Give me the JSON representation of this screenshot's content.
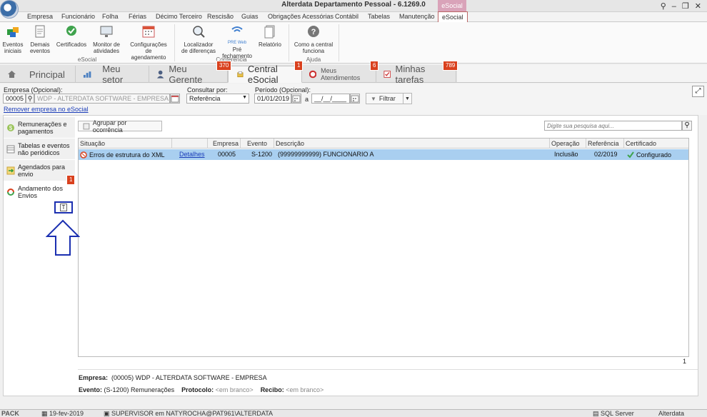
{
  "window": {
    "title": "Alterdata Departamento Pessoal - 6.1269.0",
    "context_tab": "eSocial"
  },
  "menu": [
    "Empresa",
    "Funcionário",
    "Folha",
    "Férias",
    "Décimo Terceiro",
    "Rescisão",
    "Guias",
    "Obrigações Acessórias",
    "Contábil",
    "Tabelas",
    "Manutenção",
    "eSocial"
  ],
  "ribbon": {
    "groups": [
      {
        "label": "eSocial",
        "buttons": [
          "Eventos iniciais",
          "Demais eventos",
          "Certificados",
          "Monitor de atividades",
          "Configurações de agendamento"
        ]
      },
      {
        "label": "Conferência",
        "buttons": [
          "Localizador de diferenças",
          "Pré fechamento",
          "Relatório"
        ]
      },
      {
        "label": "Ajuda",
        "buttons": [
          "Como a central funciona"
        ]
      }
    ],
    "pre_icon_text": "PRE Web"
  },
  "tabs": [
    {
      "label": "Principal",
      "badge": ""
    },
    {
      "label": "Meu setor",
      "badge": ""
    },
    {
      "label": "Meu Gerente",
      "badge": "370"
    },
    {
      "label": "Central eSocial",
      "badge": "1"
    },
    {
      "label": "Meus Atendimentos",
      "badge": "6"
    },
    {
      "label": "Minhas tarefas",
      "badge": "789"
    }
  ],
  "filters": {
    "empresa_label": "Empresa (Opcional):",
    "empresa_code": "00005",
    "empresa_name": "WDP - ALTERDATA SOFTWARE - EMPRESA",
    "remove_link": "Remover empresa no eSocial",
    "consultar_label": "Consultar por:",
    "consultar_value": "Referência",
    "periodo_label": "Período (Opcional):",
    "periodo_from": "01/01/2019",
    "periodo_sep": "a",
    "periodo_to": "__/__/____",
    "filtrar_label": "Filtrar"
  },
  "sidebar": [
    {
      "label": "Remunerações e pagamentos",
      "icon": "money-icon"
    },
    {
      "label": "Tabelas e eventos não periódicos",
      "icon": "table-icon"
    },
    {
      "label": "Agendados para envio",
      "icon": "calendar-arrow-icon"
    },
    {
      "label": "Andamento dos Envios",
      "icon": "refresh-icon",
      "badge": "1"
    }
  ],
  "toolbar": {
    "group_button": "Agrupar por ocorrência",
    "search_placeholder": "Digite sua pesquisa aqui..."
  },
  "grid": {
    "columns": [
      "Situação",
      "",
      "Empresa",
      "Evento",
      "Descrição",
      "Operação",
      "Referência",
      "Certificado"
    ],
    "rows": [
      {
        "situacao": "Erros de estrutura do XML",
        "link": "Detalhes",
        "empresa": "00005",
        "evento": "S-1200",
        "descricao": "(99999999999) FUNCIONARIO A",
        "operacao": "Inclusão",
        "referencia": "02/2019",
        "certificado": "Configurado"
      }
    ],
    "count": "1"
  },
  "details": {
    "empresa_label": "Empresa:",
    "empresa_value": "(00005) WDP - ALTERDATA SOFTWARE - EMPRESA",
    "evento_label": "Evento:",
    "evento_value": "(S-1200) Remunerações",
    "protocolo_label": "Protocolo:",
    "protocolo_value": "<em branco>",
    "recibo_label": "Recibo:",
    "recibo_value": "<em branco>"
  },
  "annotation": {
    "button_text": "T"
  },
  "status": {
    "pack": "PACK",
    "date": "19-fev-2019",
    "user": "SUPERVISOR em NATYROCHA@PAT961\\ALTERDATA",
    "db": "SQL Server",
    "brand": "Alterdata"
  },
  "colors": {
    "accent": "#d9411e",
    "selection": "#a9cff0",
    "link": "#1a3cb8",
    "annotation": "#1b2fb0"
  }
}
